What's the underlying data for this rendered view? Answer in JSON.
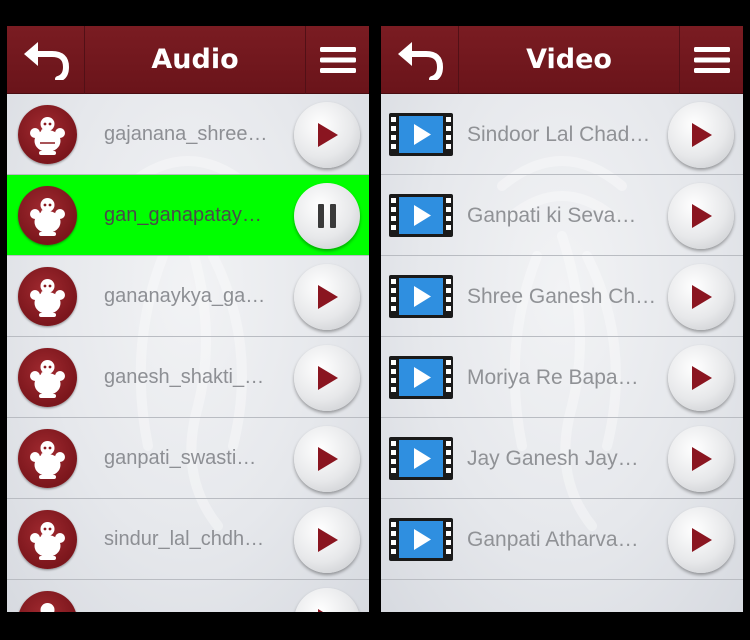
{
  "colors": {
    "header": "#6e161c",
    "active_row": "#00ff00",
    "play_icon": "#8a1520"
  },
  "audio": {
    "title": "Audio",
    "back_icon": "back-arrow-icon",
    "menu_icon": "hamburger-menu-icon",
    "items": [
      {
        "label": "gajanana_shree…",
        "state": "play"
      },
      {
        "label": "gan_ganapatay…",
        "state": "pause",
        "active": true
      },
      {
        "label": "gananaykya_ga…",
        "state": "play"
      },
      {
        "label": "ganesh_shakti_…",
        "state": "play"
      },
      {
        "label": "ganpati_swasti…",
        "state": "play"
      },
      {
        "label": "sindur_lal_chdh…",
        "state": "play"
      },
      {
        "label": "",
        "state": "play"
      }
    ]
  },
  "video": {
    "title": "Video",
    "back_icon": "back-arrow-icon",
    "menu_icon": "hamburger-menu-icon",
    "items": [
      {
        "label": "Sindoor Lal Chad…",
        "state": "play"
      },
      {
        "label": "Ganpati ki Seva…",
        "state": "play"
      },
      {
        "label": "Shree Ganesh Ch…",
        "state": "play"
      },
      {
        "label": "Moriya Re Bapa…",
        "state": "play"
      },
      {
        "label": "Jay Ganesh Jay…",
        "state": "play"
      },
      {
        "label": "Ganpati Atharva…",
        "state": "play"
      }
    ]
  }
}
